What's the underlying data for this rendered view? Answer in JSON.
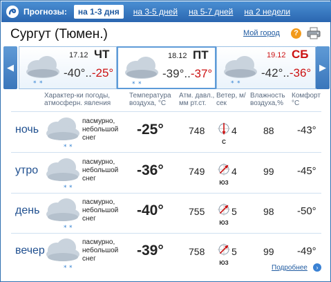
{
  "header": {
    "title": "Прогнозы:",
    "tabs": [
      {
        "label": "на 1-3 дня",
        "active": true
      },
      {
        "label": "на 3-5 дней",
        "active": false
      },
      {
        "label": "на 5-7 дней",
        "active": false
      },
      {
        "label": "на 2 недели",
        "active": false
      }
    ]
  },
  "city": "Сургут (Тюмен.)",
  "my_city_link": "Мой город",
  "help_glyph": "?",
  "days": [
    {
      "date": "17.12",
      "dow": "ЧТ",
      "tmax": "-40°",
      "sep": "..",
      "tmin": "-25°",
      "weekend": false,
      "active": false
    },
    {
      "date": "18.12",
      "dow": "ПТ",
      "tmax": "-39°",
      "sep": "..",
      "tmin": "-37°",
      "weekend": false,
      "active": true
    },
    {
      "date": "19.12",
      "dow": "СБ",
      "tmax": "-42°",
      "sep": "..",
      "tmin": "-36°",
      "weekend": true,
      "active": false
    }
  ],
  "arrows": {
    "left": "◀",
    "right": "▶"
  },
  "columns": {
    "weather": "Характер-ки погоды, атмосферн. явления",
    "temp": "Температура воздуха, °С",
    "pressure": "Атм. давл., мм рт.ст.",
    "wind": "Ветер, м/сек",
    "humidity": "Влажность воздуха,%",
    "comfort": "Комфорт °С"
  },
  "rows": [
    {
      "name": "ночь",
      "desc": "пасмурно, небольшой снег",
      "temp": "-25°",
      "pressure": "748",
      "wind_dir": "С",
      "wind_speed": "4",
      "humidity": "88",
      "comfort": "-43°",
      "wind_angle": 0
    },
    {
      "name": "утро",
      "desc": "пасмурно, небольшой снег",
      "temp": "-36°",
      "pressure": "749",
      "wind_dir": "ЮЗ",
      "wind_speed": "4",
      "humidity": "99",
      "comfort": "-45°",
      "wind_angle": 225
    },
    {
      "name": "день",
      "desc": "пасмурно, небольшой снег",
      "temp": "-40°",
      "pressure": "755",
      "wind_dir": "ЮЗ",
      "wind_speed": "5",
      "humidity": "98",
      "comfort": "-50°",
      "wind_angle": 225
    },
    {
      "name": "вечер",
      "desc": "пасмурно, небольшой снег",
      "temp": "-39°",
      "pressure": "758",
      "wind_dir": "ЮЗ",
      "wind_speed": "5",
      "humidity": "99",
      "comfort": "-49°",
      "wind_angle": 225
    }
  ],
  "more_link": "Подробнее",
  "more_glyph": "›",
  "colors": {
    "accent": "#2a66b0",
    "weekend": "#cc1111",
    "link": "#1f5aa0"
  }
}
